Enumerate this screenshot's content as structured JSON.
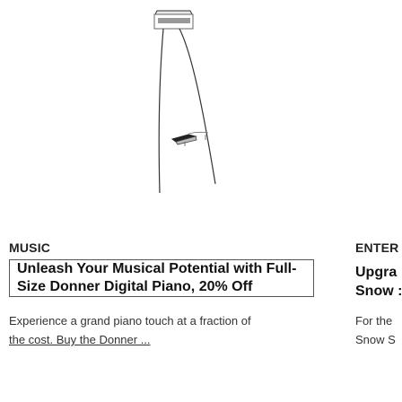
{
  "cards": [
    {
      "category": "MUSIC",
      "headline_line1": "Unleash Your Musical Potential with Full-",
      "headline_line2": "Size Donner Digital Piano, 20% Off",
      "description_line1": "Experience a grand piano touch at a fraction of",
      "description_line2": "the cost. Buy the Donner ...",
      "image_icon": "piano-lamp-sketch"
    },
    {
      "category": "ENTER",
      "headline_line1": "Upgra",
      "headline_line2": "Snow :",
      "description_line1": "For the",
      "description_line2": "Snow S"
    }
  ]
}
